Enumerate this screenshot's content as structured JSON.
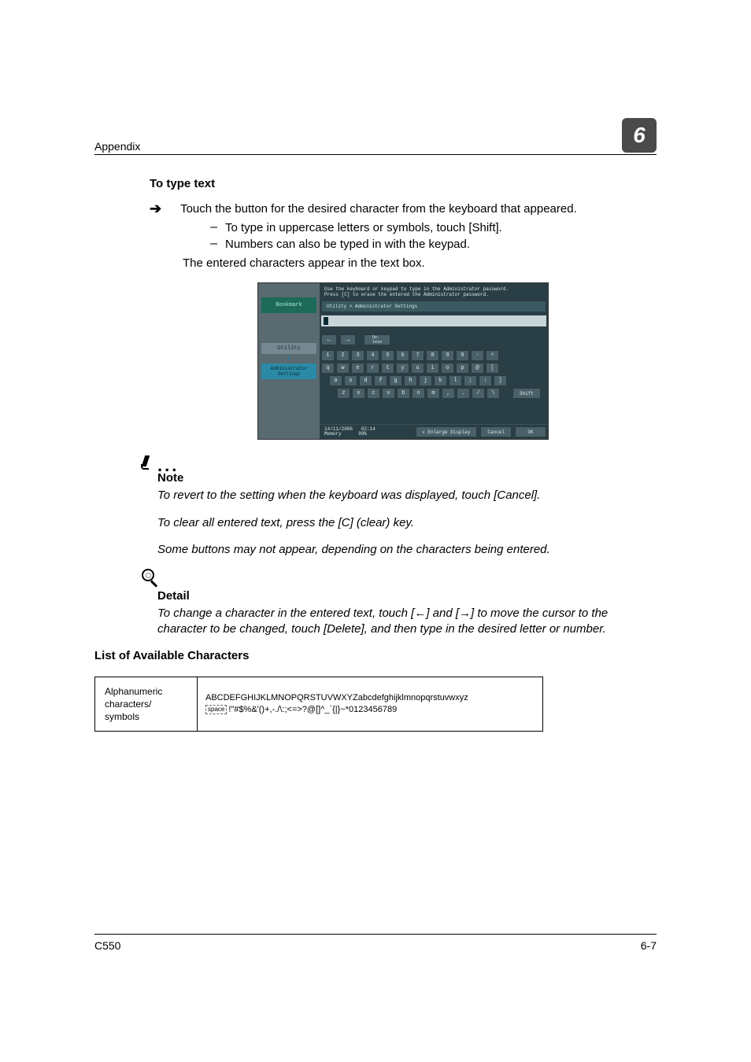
{
  "header": {
    "section": "Appendix",
    "chapter": "6"
  },
  "typing": {
    "heading": "To type text",
    "intro": "Touch the button for the desired character from the keyboard that appeared.",
    "sub1": "To type in uppercase letters or symbols, touch [Shift].",
    "sub2": "Numbers can also be typed in with the keypad.",
    "outro": "The entered characters appear in the text box."
  },
  "screenshot": {
    "msg1": "Use the keyboard or keypad to type in the Administrator password.",
    "msg2": "Press [C] to erase the entered the Administrator password.",
    "bookmark": "Bookmark",
    "utility": "Utility",
    "admin": "Administrator Settings",
    "breadcrumb": "Utility > Administrator Settings",
    "delete": "De-\nlete",
    "row1": [
      "1",
      "2",
      "3",
      "4",
      "5",
      "6",
      "7",
      "8",
      "9",
      "0",
      "-",
      "^"
    ],
    "row2": [
      "q",
      "w",
      "e",
      "r",
      "t",
      "y",
      "u",
      "i",
      "o",
      "p",
      "@",
      "["
    ],
    "row3": [
      "a",
      "s",
      "d",
      "f",
      "g",
      "h",
      "j",
      "k",
      "l",
      ";",
      ":",
      "]"
    ],
    "row4": [
      "z",
      "x",
      "c",
      "v",
      "b",
      "n",
      "m",
      ",",
      ".",
      "/",
      "\\"
    ],
    "row4_shift": "Shift",
    "date": "14/11/2006",
    "time": "02:14",
    "memory": "Memory",
    "mempct": "99%",
    "enlarge": "Enlarge Display",
    "cancel": "Cancel",
    "ok": "OK"
  },
  "note": {
    "label": "Note",
    "p1": "To revert to the setting when the keyboard was displayed, touch [Cancel].",
    "p2": "To clear all entered text, press the [C] (clear) key.",
    "p3": "Some buttons may not appear, depending on the characters being entered."
  },
  "detail": {
    "label": "Detail",
    "p1": "To change a character in the entered text, touch [←] and [→] to move the cursor to the character to be changed, touch [Delete], and then type in the desired letter or number."
  },
  "list": {
    "heading": "List of Available Characters",
    "left": "Alphanumeric characters/\nsymbols",
    "space": "space",
    "chars1": "ABCDEFGHIJKLMNOPQRSTUVWXYZabcdefghijklmnopqrstuvwxyz",
    "chars2": "!\"#$%&'()+,-./\\:;<=>?@[]^_`{|}~*0123456789"
  },
  "footer": {
    "model": "C550",
    "page": "6-7"
  }
}
